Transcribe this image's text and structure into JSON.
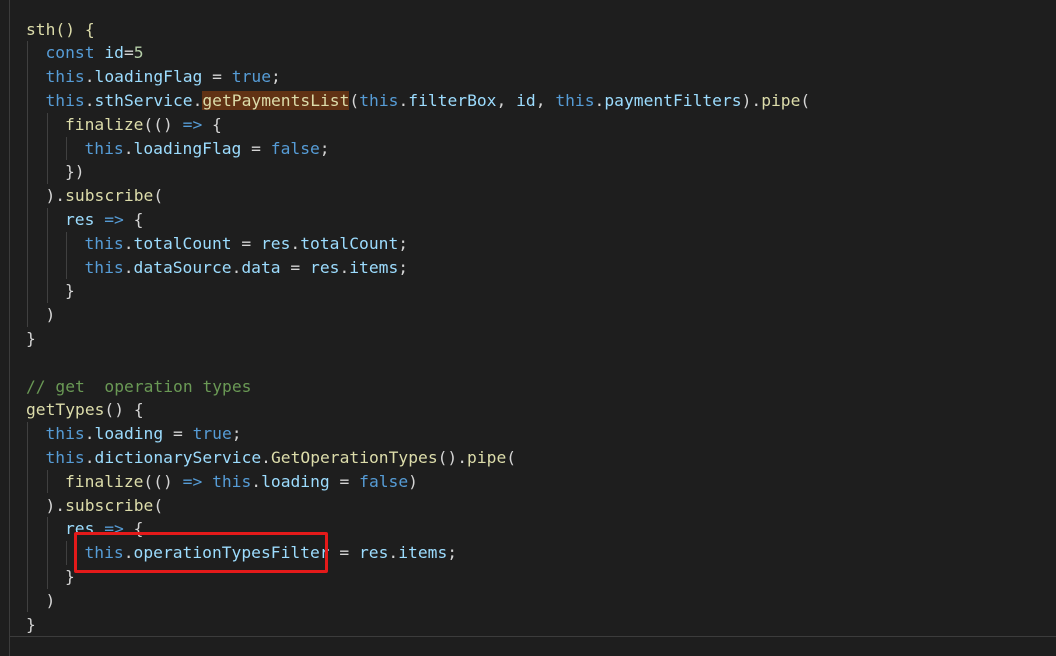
{
  "editor": {
    "colors": {
      "background": "#1e1e1e",
      "keyword": "#569cd6",
      "identifier": "#9cdcfe",
      "function": "#dcdcaa",
      "number": "#b5cea8",
      "comment": "#6a9955",
      "plain": "#d4d4d4",
      "highlight": "#613214",
      "annotation_box": "#e41a1a"
    },
    "lines": [
      [
        {
          "t": "sth() {",
          "c": "fn"
        }
      ],
      [
        {
          "t": "const ",
          "c": "kw"
        },
        {
          "t": "id",
          "c": "id"
        },
        {
          "t": "=",
          "c": "pl"
        },
        {
          "t": "5",
          "c": "num"
        }
      ],
      [
        {
          "t": "this",
          "c": "kw"
        },
        {
          "t": ".",
          "c": "pl"
        },
        {
          "t": "loadingFlag",
          "c": "id"
        },
        {
          "t": " = ",
          "c": "pl"
        },
        {
          "t": "true",
          "c": "kw"
        },
        {
          "t": ";",
          "c": "pl"
        }
      ],
      [
        {
          "t": "this",
          "c": "kw"
        },
        {
          "t": ".",
          "c": "pl"
        },
        {
          "t": "sthService",
          "c": "id"
        },
        {
          "t": ".",
          "c": "pl"
        },
        {
          "t": "getPaymentsList",
          "c": "fn",
          "h": true
        },
        {
          "t": "(",
          "c": "pl"
        },
        {
          "t": "this",
          "c": "kw"
        },
        {
          "t": ".",
          "c": "pl"
        },
        {
          "t": "filterBox",
          "c": "id"
        },
        {
          "t": ", ",
          "c": "pl"
        },
        {
          "t": "id",
          "c": "id"
        },
        {
          "t": ", ",
          "c": "pl"
        },
        {
          "t": "this",
          "c": "kw"
        },
        {
          "t": ".",
          "c": "pl"
        },
        {
          "t": "paymentFilters",
          "c": "id"
        },
        {
          "t": ").",
          "c": "pl"
        },
        {
          "t": "pipe",
          "c": "fn"
        },
        {
          "t": "(",
          "c": "pl"
        }
      ],
      [
        {
          "t": "finalize",
          "c": "fn"
        },
        {
          "t": "(() ",
          "c": "pl"
        },
        {
          "t": "=>",
          "c": "kw"
        },
        {
          "t": " {",
          "c": "pl"
        }
      ],
      [
        {
          "t": "this",
          "c": "kw"
        },
        {
          "t": ".",
          "c": "pl"
        },
        {
          "t": "loadingFlag",
          "c": "id"
        },
        {
          "t": " = ",
          "c": "pl"
        },
        {
          "t": "false",
          "c": "kw"
        },
        {
          "t": ";",
          "c": "pl"
        }
      ],
      [
        {
          "t": "})",
          "c": "pl"
        }
      ],
      [
        {
          "t": ").",
          "c": "pl"
        },
        {
          "t": "subscribe",
          "c": "fn"
        },
        {
          "t": "(",
          "c": "pl"
        }
      ],
      [
        {
          "t": "res",
          "c": "id"
        },
        {
          "t": " ",
          "c": "pl"
        },
        {
          "t": "=>",
          "c": "kw"
        },
        {
          "t": " {",
          "c": "pl"
        }
      ],
      [
        {
          "t": "this",
          "c": "kw"
        },
        {
          "t": ".",
          "c": "pl"
        },
        {
          "t": "totalCount",
          "c": "id"
        },
        {
          "t": " = ",
          "c": "pl"
        },
        {
          "t": "res",
          "c": "id"
        },
        {
          "t": ".",
          "c": "pl"
        },
        {
          "t": "totalCount",
          "c": "id"
        },
        {
          "t": ";",
          "c": "pl"
        }
      ],
      [
        {
          "t": "this",
          "c": "kw"
        },
        {
          "t": ".",
          "c": "pl"
        },
        {
          "t": "dataSource",
          "c": "id"
        },
        {
          "t": ".",
          "c": "pl"
        },
        {
          "t": "data",
          "c": "id"
        },
        {
          "t": " = ",
          "c": "pl"
        },
        {
          "t": "res",
          "c": "id"
        },
        {
          "t": ".",
          "c": "pl"
        },
        {
          "t": "items",
          "c": "id"
        },
        {
          "t": ";",
          "c": "pl"
        }
      ],
      [
        {
          "t": "}",
          "c": "pl"
        }
      ],
      [
        {
          "t": ")",
          "c": "pl"
        }
      ],
      [
        {
          "t": "}",
          "c": "pl"
        }
      ],
      [],
      [
        {
          "t": "// get  operation types",
          "c": "cm"
        }
      ],
      [
        {
          "t": "getTypes",
          "c": "fn"
        },
        {
          "t": "() {",
          "c": "pl"
        }
      ],
      [
        {
          "t": "this",
          "c": "kw"
        },
        {
          "t": ".",
          "c": "pl"
        },
        {
          "t": "loading",
          "c": "id"
        },
        {
          "t": " = ",
          "c": "pl"
        },
        {
          "t": "true",
          "c": "kw"
        },
        {
          "t": ";",
          "c": "pl"
        }
      ],
      [
        {
          "t": "this",
          "c": "kw"
        },
        {
          "t": ".",
          "c": "pl"
        },
        {
          "t": "dictionaryService",
          "c": "id"
        },
        {
          "t": ".",
          "c": "pl"
        },
        {
          "t": "GetOperationTypes",
          "c": "fn"
        },
        {
          "t": "().",
          "c": "pl"
        },
        {
          "t": "pipe",
          "c": "fn"
        },
        {
          "t": "(",
          "c": "pl"
        }
      ],
      [
        {
          "t": "finalize",
          "c": "fn"
        },
        {
          "t": "(() ",
          "c": "pl"
        },
        {
          "t": "=>",
          "c": "kw"
        },
        {
          "t": " ",
          "c": "pl"
        },
        {
          "t": "this",
          "c": "kw"
        },
        {
          "t": ".",
          "c": "pl"
        },
        {
          "t": "loading",
          "c": "id"
        },
        {
          "t": " = ",
          "c": "pl"
        },
        {
          "t": "false",
          "c": "kw"
        },
        {
          "t": ")",
          "c": "pl"
        }
      ],
      [
        {
          "t": ").",
          "c": "pl"
        },
        {
          "t": "subscribe",
          "c": "fn"
        },
        {
          "t": "(",
          "c": "pl"
        }
      ],
      [
        {
          "t": "res",
          "c": "id"
        },
        {
          "t": " ",
          "c": "pl"
        },
        {
          "t": "=>",
          "c": "kw"
        },
        {
          "t": " {",
          "c": "pl"
        }
      ],
      [
        {
          "t": "this",
          "c": "kw"
        },
        {
          "t": ".",
          "c": "pl"
        },
        {
          "t": "operationTypesFilter",
          "c": "id"
        },
        {
          "t": " = ",
          "c": "pl"
        },
        {
          "t": "res",
          "c": "id"
        },
        {
          "t": ".",
          "c": "pl"
        },
        {
          "t": "items",
          "c": "id"
        },
        {
          "t": ";",
          "c": "pl"
        }
      ],
      [
        {
          "t": "}",
          "c": "pl"
        }
      ],
      [
        {
          "t": ")",
          "c": "pl"
        }
      ],
      [
        {
          "t": "}",
          "c": "pl"
        }
      ]
    ]
  }
}
